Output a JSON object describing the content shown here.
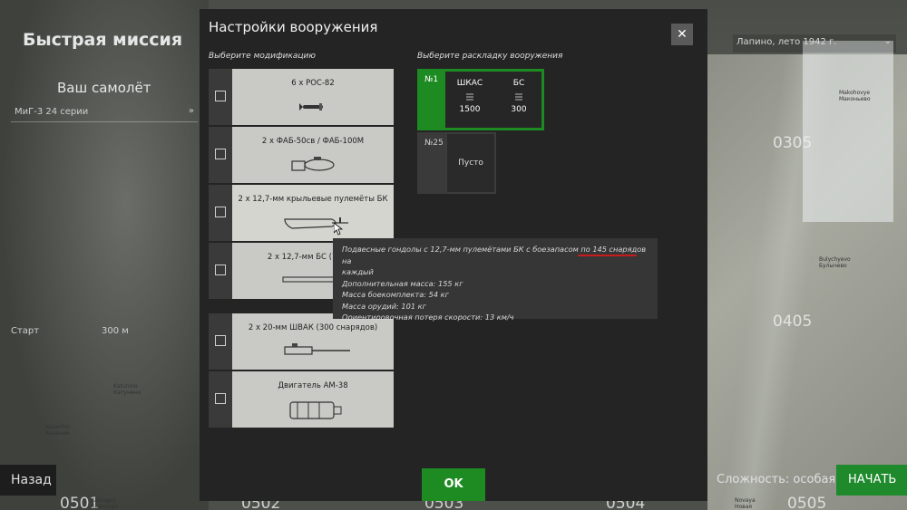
{
  "background": {
    "title": "Быстрая миссия",
    "plane_label": "Ваш самолёт",
    "plane_select": "МиГ-3 24 серии",
    "start_label": "Старт",
    "start_value": "300 м",
    "date_select": "Лапино, лето 1942 г.",
    "grid_labels": [
      "0305",
      "0405",
      "0502",
      "0503",
      "0504",
      "0505",
      "0501"
    ],
    "towns": [
      {
        "line1": "Makohovye",
        "line2": "Маконьево"
      },
      {
        "line1": "Bulychyevo",
        "line2": "Булычево"
      },
      {
        "line1": "Katunino",
        "line2": "Катунино"
      },
      {
        "line1": "Kazachni",
        "line2": "Казачий"
      },
      {
        "line1": "Kaznapul",
        "line2": "Казнопул"
      },
      {
        "line1": "Novaya",
        "line2": "Новая"
      }
    ],
    "back_button": "Назад",
    "difficulty": "Сложность: особая",
    "start_button": "НАЧАТЬ",
    "accent_green": "#1f8a2c"
  },
  "dialog": {
    "title": "Настройки вооружения",
    "close_label": "✕",
    "mods_label": "Выберите модификацию",
    "loadout_label": "Выберите раскладку вооружения",
    "modifications": [
      {
        "name": "6 x РОС-82",
        "checked": false
      },
      {
        "name": "2 x ФАБ-50св / ФАБ-100М",
        "checked": false
      },
      {
        "name": "2 x 12,7-мм крыльевые пулемёты БК",
        "checked": false
      },
      {
        "name": "2 x 12,7-мм БС (700 сн",
        "checked": false
      },
      {
        "name": "2 x 20-мм ШВАК (300 снарядов)",
        "checked": false
      },
      {
        "name": "Двигатель АМ-38",
        "checked": false
      }
    ],
    "loadouts": [
      {
        "number": "№1",
        "selected": true,
        "slots": [
          {
            "name": "ШКАС",
            "count": "1500"
          },
          {
            "name": "БС",
            "count": "300"
          }
        ]
      },
      {
        "number": "№25",
        "selected": false,
        "slots": [
          {
            "name": "Пусто",
            "count": ""
          }
        ]
      }
    ],
    "tooltip": {
      "lines": [
        "Подвесные гондолы с 12,7-мм пулемётами БК с боезапасом по 145 снарядов на",
        "каждый",
        "Дополнительная масса: 155 кг",
        "Масса боекомплекта: 54 кг",
        "Масса орудий: 101 кг",
        "Ориентировочная потеря скорости: 13 км/ч"
      ]
    },
    "ok_button": "OK",
    "selected_color": "#1d8a22"
  }
}
